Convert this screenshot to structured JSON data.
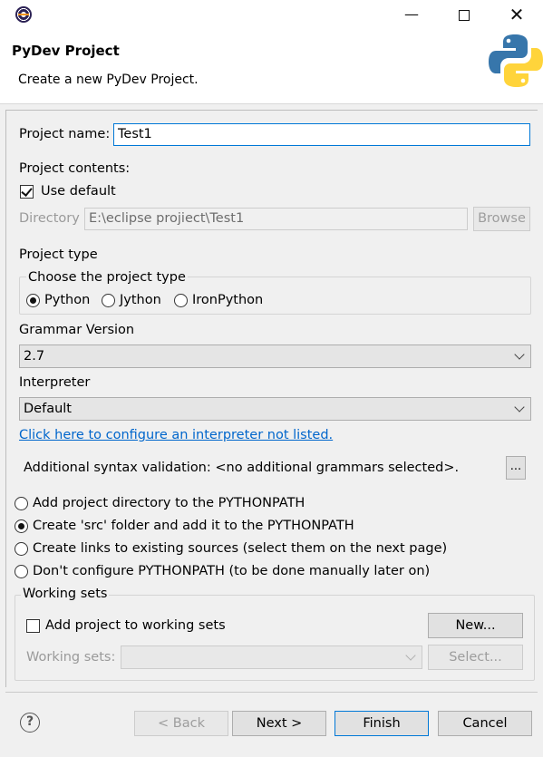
{
  "window": {
    "title": ""
  },
  "header": {
    "title": "PyDev Project",
    "description": "Create a new PyDev Project."
  },
  "project_name": {
    "label": "Project name:",
    "value": "Test1"
  },
  "project_contents": {
    "label": "Project contents:",
    "use_default_label": "Use default",
    "use_default_checked": true,
    "directory_label": "Directory",
    "directory_value": "E:\\eclipse projiect\\Test1",
    "browse_label": "Browse"
  },
  "project_type": {
    "label": "Project type",
    "group_label": "Choose the project type",
    "options": [
      "Python",
      "Jython",
      "IronPython"
    ],
    "selected": "Python"
  },
  "grammar": {
    "label": "Grammar Version",
    "value": "2.7"
  },
  "interpreter": {
    "label": "Interpreter",
    "value": "Default",
    "configure_link": "Click here to configure an interpreter not listed."
  },
  "syntax_validation": {
    "text": "Additional syntax validation: <no additional grammars selected>.",
    "button_label": "..."
  },
  "pythonpath_options": [
    "Add project directory to the PYTHONPATH",
    "Create 'src' folder and add it to the PYTHONPATH",
    "Create links to existing sources (select them on the next page)",
    "Don't configure PYTHONPATH (to be done manually later on)"
  ],
  "pythonpath_selected_index": 1,
  "working_sets": {
    "group_label": "Working sets",
    "add_label": "Add project to working sets",
    "add_checked": false,
    "new_button": "New...",
    "sets_label": "Working sets:",
    "sets_value": "",
    "select_button": "Select..."
  },
  "footer": {
    "help_glyph": "?",
    "back_label": "< Back",
    "next_label": "Next >",
    "finish_label": "Finish",
    "cancel_label": "Cancel"
  },
  "icons": {
    "app": "eclipse-icon",
    "minimize": "minimize-icon",
    "maximize": "maximize-icon",
    "close": "close-icon",
    "python_logo": "python-logo-icon",
    "help": "help-icon",
    "dropdown": "chevron-down-icon"
  },
  "colors": {
    "link": "#0066cc",
    "focus_border": "#0078d7",
    "python_blue": "#3776ab",
    "python_yellow": "#ffd43b"
  }
}
